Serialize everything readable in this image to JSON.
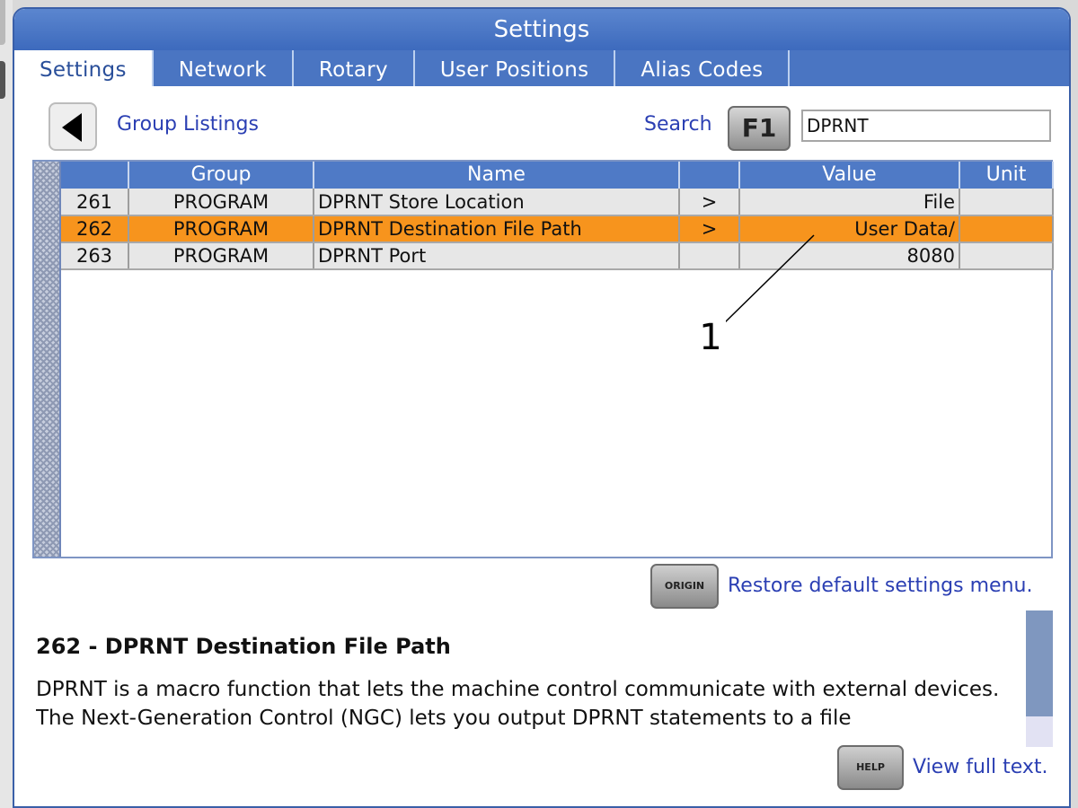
{
  "window": {
    "title": "Settings"
  },
  "tabs": [
    {
      "label": "Settings",
      "active": true
    },
    {
      "label": "Network",
      "active": false
    },
    {
      "label": "Rotary",
      "active": false
    },
    {
      "label": "User Positions",
      "active": false
    },
    {
      "label": "Alias Codes",
      "active": false
    }
  ],
  "toolbar": {
    "back_icon": "left-triangle-icon",
    "group_link": "Group Listings",
    "search_label": "Search",
    "search_key": "F1",
    "search_value": "DPRNT"
  },
  "grid": {
    "columns": [
      "",
      "Group",
      "Name",
      "",
      "Value",
      "Unit"
    ],
    "rows": [
      {
        "num": "261",
        "group": "PROGRAM",
        "name": "DPRNT Store Location",
        "arrow": ">",
        "value": "File",
        "unit": "",
        "selected": false
      },
      {
        "num": "262",
        "group": "PROGRAM",
        "name": "DPRNT Destination File Path",
        "arrow": ">",
        "value": "User Data/",
        "unit": "",
        "selected": true
      },
      {
        "num": "263",
        "group": "PROGRAM",
        "name": "DPRNT Port",
        "arrow": "",
        "value": "8080",
        "unit": "",
        "selected": false
      }
    ],
    "selected_color": "#f7941d"
  },
  "callout": {
    "label": "1"
  },
  "restore": {
    "key": "ORIGIN",
    "label": "Restore default settings menu."
  },
  "description": {
    "title": "262 - DPRNT Destination File Path",
    "body": "DPRNT is a macro function that lets the machine control communicate with external devices. The Next-Generation Control (NGC) lets you output DPRNT statements to a file"
  },
  "help": {
    "key": "HELP",
    "label": "View full text."
  },
  "colors": {
    "title_bar": "#4a75c2",
    "link": "#2b3fb3"
  }
}
